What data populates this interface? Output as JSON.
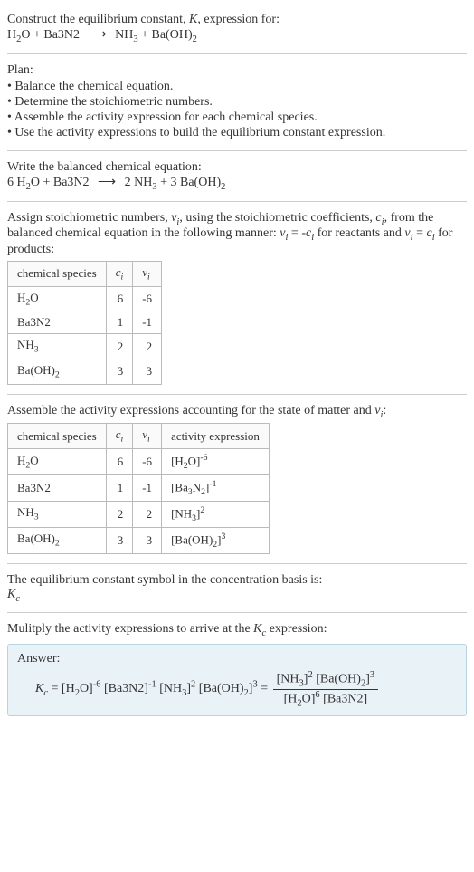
{
  "header": {
    "line1": "Construct the equilibrium constant, K, expression for:",
    "equation": "H₂O + Ba3N2 ⟶ NH₃ + Ba(OH)₂"
  },
  "plan": {
    "title": "Plan:",
    "items": [
      "• Balance the chemical equation.",
      "• Determine the stoichiometric numbers.",
      "• Assemble the activity expression for each chemical species.",
      "• Use the activity expressions to build the equilibrium constant expression."
    ]
  },
  "balanced": {
    "title": "Write the balanced chemical equation:",
    "equation": "6 H₂O + Ba3N2 ⟶ 2 NH₃ + 3 Ba(OH)₂"
  },
  "assign": {
    "text": "Assign stoichiometric numbers, νᵢ, using the stoichiometric coefficients, cᵢ, from the balanced chemical equation in the following manner: νᵢ = -cᵢ for reactants and νᵢ = cᵢ for products:",
    "headers": [
      "chemical species",
      "cᵢ",
      "νᵢ"
    ],
    "rows": [
      {
        "species": "H₂O",
        "c": "6",
        "v": "-6"
      },
      {
        "species": "Ba3N2",
        "c": "1",
        "v": "-1"
      },
      {
        "species": "NH₃",
        "c": "2",
        "v": "2"
      },
      {
        "species": "Ba(OH)₂",
        "c": "3",
        "v": "3"
      }
    ]
  },
  "activity": {
    "text": "Assemble the activity expressions accounting for the state of matter and νᵢ:",
    "headers": [
      "chemical species",
      "cᵢ",
      "νᵢ",
      "activity expression"
    ],
    "rows": [
      {
        "species": "H₂O",
        "c": "6",
        "v": "-6",
        "act": "[H₂O]⁻⁶"
      },
      {
        "species": "Ba3N2",
        "c": "1",
        "v": "-1",
        "act": "[Ba₃N₂]⁻¹"
      },
      {
        "species": "NH₃",
        "c": "2",
        "v": "2",
        "act": "[NH₃]²"
      },
      {
        "species": "Ba(OH)₂",
        "c": "3",
        "v": "3",
        "act": "[Ba(OH)₂]³"
      }
    ]
  },
  "symbol": {
    "line1": "The equilibrium constant symbol in the concentration basis is:",
    "line2": "K_c"
  },
  "multiply": {
    "text": "Mulitply the activity expressions to arrive at the K_c expression:"
  },
  "answer": {
    "label": "Answer:",
    "lhs": "K_c = [H₂O]⁻⁶ [Ba3N2]⁻¹ [NH₃]² [Ba(OH)₂]³ =",
    "frac_num": "[NH₃]² [Ba(OH)₂]³",
    "frac_den": "[H₂O]⁶ [Ba3N2]"
  },
  "chart_data": {
    "type": "table",
    "tables": [
      {
        "title": "Stoichiometric numbers",
        "columns": [
          "chemical species",
          "c_i",
          "ν_i"
        ],
        "rows": [
          [
            "H2O",
            6,
            -6
          ],
          [
            "Ba3N2",
            1,
            -1
          ],
          [
            "NH3",
            2,
            2
          ],
          [
            "Ba(OH)2",
            3,
            3
          ]
        ]
      },
      {
        "title": "Activity expressions",
        "columns": [
          "chemical species",
          "c_i",
          "ν_i",
          "activity expression"
        ],
        "rows": [
          [
            "H2O",
            6,
            -6,
            "[H2O]^-6"
          ],
          [
            "Ba3N2",
            1,
            -1,
            "[Ba3N2]^-1"
          ],
          [
            "NH3",
            2,
            2,
            "[NH3]^2"
          ],
          [
            "Ba(OH)2",
            3,
            3,
            "[Ba(OH)2]^3"
          ]
        ]
      }
    ]
  }
}
